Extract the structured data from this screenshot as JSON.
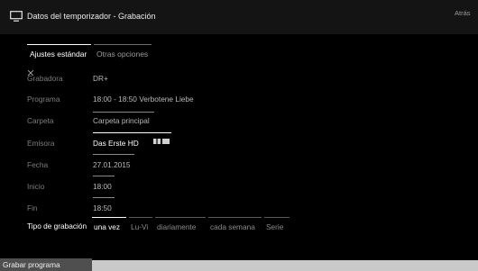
{
  "header": {
    "title": "Datos del temporizador - Grabación",
    "back_label": "Atrás"
  },
  "tabs": [
    {
      "label": "Ajustes estándar",
      "active": true
    },
    {
      "label": "Otras opciones",
      "active": false
    }
  ],
  "fields": {
    "recorder": {
      "label": "Grabadora",
      "value": "DR+"
    },
    "program": {
      "label": "Programa",
      "value": "18:00 - 18:50 Verbotene Liebe"
    },
    "folder": {
      "label": "Carpeta",
      "value": "Carpeta principal"
    },
    "channel": {
      "label": "Emisora",
      "value": "Das Erste HD"
    },
    "date": {
      "label": "Fecha",
      "value": "27.01.2015"
    },
    "start": {
      "label": "Inicio",
      "value": "18:00"
    },
    "end": {
      "label": "Fin",
      "value": "18:50"
    }
  },
  "recording_type": {
    "label": "Tipo de grabación",
    "options": [
      "una vez",
      "Lu-Vi",
      "diariamente",
      "cada semana",
      "Serie"
    ],
    "selected": "una vez"
  },
  "footer": {
    "record_button": "Grabar programa"
  },
  "colors": {
    "background": "#000000",
    "header": "#141414",
    "footer_bar": "#c9c9c9",
    "button": "#4f4f4f"
  }
}
